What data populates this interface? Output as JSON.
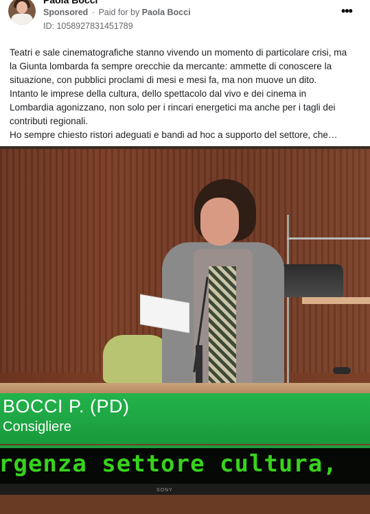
{
  "post": {
    "page_name": "Paola Bocci",
    "sponsored_label": "Sponsored",
    "separator": "·",
    "paid_for_prefix": "Paid for by",
    "paid_for_name": "Paola Bocci",
    "ad_id": "ID: 1058927831451789",
    "more_icon": "more-dots-icon",
    "text_lines": [
      "Teatri e sale cinematografiche stanno vivendo un momento di particolare crisi, ma",
      "la Giunta lombarda fa sempre orecchie da mercante: ammette di conoscere la",
      "situazione, con pubblici proclami di mesi e mesi fa, ma non muove un dito.",
      "Intanto le imprese della cultura, dello spettacolo dal vivo e dei cinema in",
      "Lombardia agonizzano, non solo per i rincari energetici ma anche per i tagli dei",
      "contributi regionali.",
      "Ho sempre chiesto ristori adeguati e bandi ad hoc a supporto del settore, che…"
    ]
  },
  "image": {
    "caption_name": "BOCCI P. (PD)",
    "caption_role": "Consigliere",
    "ticker": "rgenza settore cultura,",
    "tv_brand": "SONY"
  },
  "colors": {
    "caption_green": "#1ea544",
    "ticker_text": "#38d21e",
    "meta_gray": "#65676b"
  }
}
